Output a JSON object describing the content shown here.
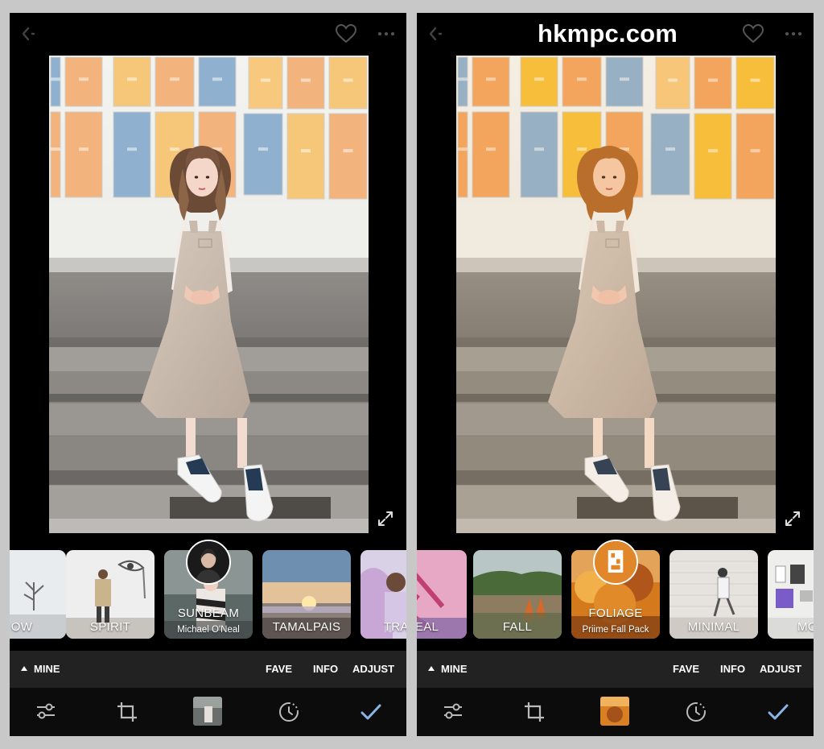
{
  "watermark": "hkmpc.com",
  "panels": [
    {
      "id": "left",
      "variant": "original",
      "selected_filter": "SUNBEAM",
      "filters": [
        {
          "name": "OW",
          "subtitle": "",
          "theme": "snow",
          "selected": false
        },
        {
          "name": "SPIRIT",
          "subtitle": "",
          "theme": "spirit",
          "selected": false
        },
        {
          "name": "SUNBEAM",
          "subtitle": "Michael O'Neal",
          "theme": "sunbeam",
          "selected": true
        },
        {
          "name": "TAMALPAIS",
          "subtitle": "",
          "theme": "tamalpais",
          "selected": false
        },
        {
          "name": "TRANS",
          "subtitle": "",
          "theme": "trans",
          "selected": false
        }
      ]
    },
    {
      "id": "right",
      "variant": "warm",
      "selected_filter": "FOLIAGE",
      "filters": [
        {
          "name": "REAL",
          "subtitle": "",
          "theme": "real",
          "selected": false
        },
        {
          "name": "FALL",
          "subtitle": "",
          "theme": "fall",
          "selected": false
        },
        {
          "name": "FOLIAGE",
          "subtitle": "Priime Fall Pack",
          "theme": "foliage",
          "selected": true
        },
        {
          "name": "MINIMAL",
          "subtitle": "",
          "theme": "minimal",
          "selected": false
        },
        {
          "name": "MOD",
          "subtitle": "",
          "theme": "mod",
          "selected": false
        }
      ]
    }
  ],
  "nav": {
    "mine": "MINE",
    "fave": "FAVE",
    "info": "INFO",
    "adjust": "ADJUST"
  },
  "toolbar": {
    "icons": [
      "sliders-icon",
      "crop-icon",
      "filter-preview-thumbnail",
      "history-icon",
      "checkmark-icon"
    ]
  },
  "colors": {
    "background": "#c8c8c8",
    "panel": "#000000",
    "nav_bar": "#222222",
    "toolbar": "#0c0c0c",
    "accent_check": "#8ab4e6"
  }
}
